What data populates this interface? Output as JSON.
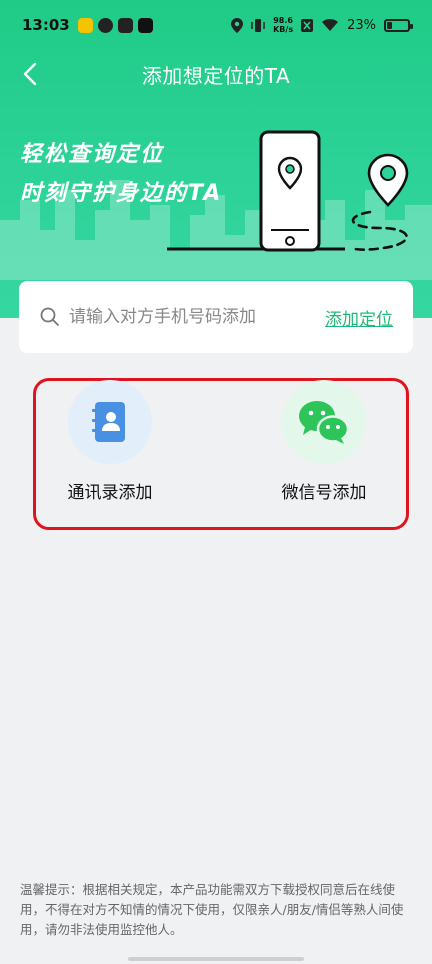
{
  "status_bar": {
    "time": "13:03",
    "speed_value": "98.6",
    "speed_unit": "KB/s",
    "battery": "23%",
    "battery_level": 0.23,
    "apps": [
      "weibo-icon",
      "app-icon",
      "mail-icon",
      "tiktok-icon"
    ]
  },
  "nav": {
    "title": "添加想定位的TA",
    "back_icon": "back-arrow-icon"
  },
  "hero": {
    "slogan_line1": "轻松查询定位",
    "slogan_line2": "时刻守护身边的TA"
  },
  "search": {
    "placeholder": "请输入对方手机号码添加",
    "value": "",
    "action_label": "添加定位"
  },
  "options": [
    {
      "label": "通讯录添加",
      "icon": "contacts-book-icon"
    },
    {
      "label": "微信号添加",
      "icon": "wechat-icon"
    }
  ],
  "tip": "温馨提示：根据相关规定，本产品功能需双方下载授权同意后在线使用，不得在对方不知情的情况下使用，仅限亲人/朋友/情侣等熟人间使用，请勿非法使用监控他人。",
  "colors": {
    "brand_green": "#1fcb86",
    "link_green": "#1fb87a",
    "annotation_red": "#e0141e",
    "contacts_blue": "#4a90e2",
    "wechat_green": "#2dc45a"
  }
}
